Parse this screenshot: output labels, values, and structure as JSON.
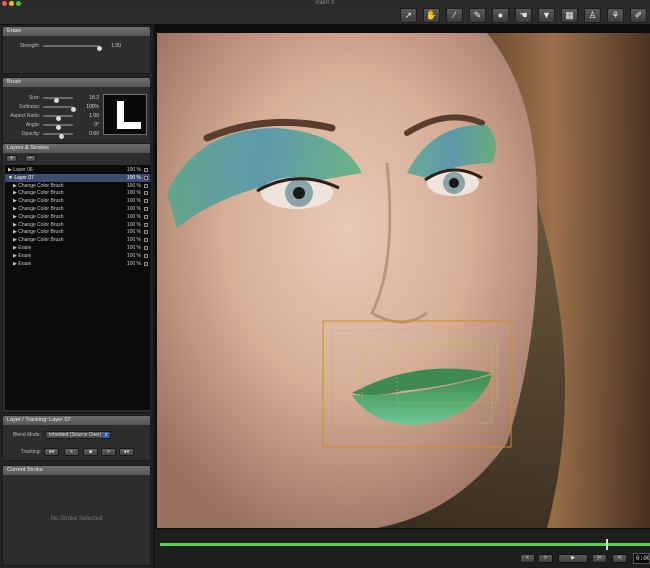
{
  "app": {
    "title": "Paint X"
  },
  "toolbar": {
    "tools": [
      {
        "name": "select-tool",
        "icon": "arrow-pointer-icon",
        "glyph": "➚"
      },
      {
        "name": "hand-tool",
        "icon": "hand-icon",
        "glyph": "✋"
      },
      {
        "name": "brush-tool",
        "icon": "paint-brush-icon",
        "glyph": "⁄"
      },
      {
        "name": "color-brush-tool",
        "icon": "color-brush-icon",
        "glyph": "✎"
      },
      {
        "name": "drop-tool",
        "icon": "drop-icon",
        "glyph": "●"
      },
      {
        "name": "smudge-tool",
        "icon": "smudge-icon",
        "glyph": "☚"
      },
      {
        "name": "mask-tool",
        "icon": "triangle-down-icon",
        "glyph": "▼"
      },
      {
        "name": "grid-tool",
        "icon": "grid-icon",
        "glyph": "▦"
      },
      {
        "name": "stamp-tool",
        "icon": "stamp-icon",
        "glyph": "♙"
      },
      {
        "name": "clone-tool",
        "icon": "clone-brush-icon",
        "glyph": "⚘"
      },
      {
        "name": "dodge-tool",
        "icon": "dodge-brush-icon",
        "glyph": "✐"
      },
      {
        "name": "eraser-tool",
        "icon": "eraser-icon",
        "glyph": "◪"
      }
    ],
    "active_index": 11
  },
  "erase": {
    "title": "Erase",
    "strength": {
      "label": "Strength:",
      "value": "1.00",
      "fraction": 1.0
    }
  },
  "brush": {
    "title": "Brush",
    "params": [
      {
        "label": "Size:",
        "value": "18.2",
        "fraction": 0.45
      },
      {
        "label": "Softness:",
        "value": "100%",
        "fraction": 1.0
      },
      {
        "label": "Aspect Ratio:",
        "value": "1.00",
        "fraction": 0.5
      },
      {
        "label": "Angle:",
        "value": "0°",
        "fraction": 0.5
      },
      {
        "label": "Opacity:",
        "value": "0.60",
        "fraction": 0.6
      }
    ]
  },
  "layers": {
    "title": "Layers & Strokes",
    "add_label": "+",
    "remove_label": "−",
    "rows": [
      {
        "name": "▶ Layer 06",
        "pct": "100 %",
        "indent": 0,
        "selected": false
      },
      {
        "name": "▼ Layer 07",
        "pct": "100 %",
        "indent": 0,
        "selected": true
      },
      {
        "name": "▶ Change Color Brush",
        "pct": "100 %",
        "indent": 1,
        "selected": false
      },
      {
        "name": "▶ Change Color Brush",
        "pct": "100 %",
        "indent": 1,
        "selected": false
      },
      {
        "name": "▶ Change Color Brush",
        "pct": "100 %",
        "indent": 1,
        "selected": false
      },
      {
        "name": "▶ Change Color Brush",
        "pct": "100 %",
        "indent": 1,
        "selected": false
      },
      {
        "name": "▶ Change Color Brush",
        "pct": "100 %",
        "indent": 1,
        "selected": false
      },
      {
        "name": "▶ Change Color Brush",
        "pct": "100 %",
        "indent": 1,
        "selected": false
      },
      {
        "name": "▶ Change Color Brush",
        "pct": "100 %",
        "indent": 1,
        "selected": false
      },
      {
        "name": "▶ Change Color Brush",
        "pct": "100 %",
        "indent": 1,
        "selected": false
      },
      {
        "name": "▶ Erase",
        "pct": "100 %",
        "indent": 1,
        "selected": false
      },
      {
        "name": "▶ Erase",
        "pct": "100 %",
        "indent": 1,
        "selected": false
      },
      {
        "name": "▶ Erase",
        "pct": "100 %",
        "indent": 1,
        "selected": false
      }
    ]
  },
  "tracking": {
    "title": "Layer / Tracking: Layer 07",
    "blend_label": "Blend Mode:",
    "blend_value": "Inherited (Source Over)",
    "tracking_label": "Tracking:",
    "buttons": [
      {
        "name": "tracking-options-button",
        "label": "●▾",
        "icon": "gear-icon"
      },
      {
        "name": "track-backward-button",
        "label": "<",
        "icon": "chevron-left-icon"
      },
      {
        "name": "track-stop-button",
        "label": "■",
        "icon": "stop-icon"
      },
      {
        "name": "track-forward-button",
        "label": ">",
        "icon": "chevron-right-icon"
      },
      {
        "name": "tracking-settings-button",
        "label": "●▾",
        "icon": "gear-icon"
      }
    ]
  },
  "current_stroke": {
    "title": "Current Stroke",
    "empty_text": "No Stroke Selected"
  },
  "playback": {
    "buttons": [
      {
        "name": "prev-frame-button",
        "label": "<",
        "icon": "chevron-left-icon"
      },
      {
        "name": "next-frame-button",
        "label": ">",
        "icon": "chevron-right-icon"
      },
      {
        "name": "play-button",
        "label": "▶",
        "icon": "play-icon"
      },
      {
        "name": "go-start-button",
        "label": "|<",
        "icon": "skip-start-icon"
      },
      {
        "name": "go-end-button",
        "label": ">|",
        "icon": "skip-end-icon"
      }
    ],
    "timecode": "0:00",
    "position": 0.91
  },
  "colors": {
    "selection": "#3f4b70",
    "timeline": "#5bd451",
    "tracking_box": "#c8921e"
  }
}
